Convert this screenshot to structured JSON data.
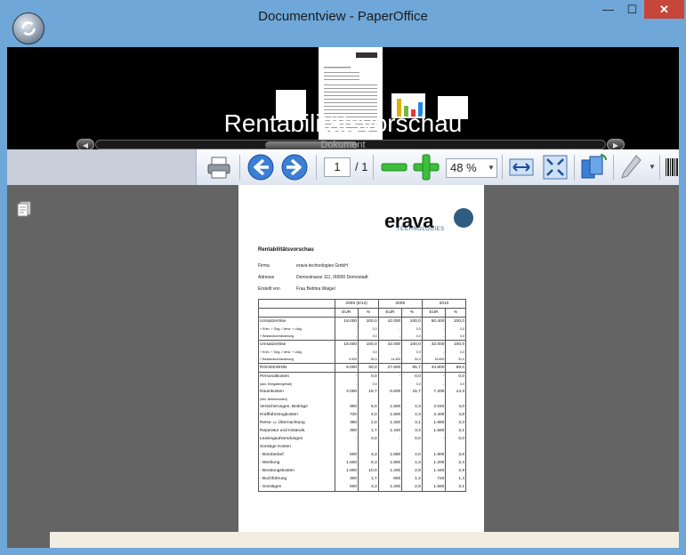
{
  "window": {
    "title": "Documentview - PaperOffice"
  },
  "titlebar": {
    "minimize": "—",
    "maximize": "☐",
    "close": "✕"
  },
  "filmstrip": {
    "title": "Rentabilitätsvorschau",
    "subtitle": "Dokument"
  },
  "toolbar": {
    "page_current": "1",
    "page_total": "/ 1",
    "zoom": "48 %"
  },
  "document": {
    "logo": "erava",
    "logo_sub": "TECHNOLOGIES",
    "title": "Rentabilitätsvorschau",
    "meta": [
      {
        "label": "Firma",
        "value": "erava technologies GmbH"
      },
      {
        "label": "Adresse",
        "value": "Demostrasse 111, 00000 Demostadt"
      },
      {
        "label": "Erstellt von",
        "value": "Frau Bettina Waigel"
      }
    ],
    "years": [
      "2009 (6/12)",
      "2009",
      "2010"
    ],
    "units": [
      "EUR",
      "%",
      "EUR",
      "%",
      "EUR",
      "%"
    ],
    "rows": [
      {
        "label": "Umsatzerlöse",
        "v": [
          "18.000",
          "100,0",
          "42.000",
          "100,0",
          "50.400",
          "100,0"
        ],
        "style": ""
      },
      {
        "label": "+ Erlm. + Geg. / Verw. + Ustg.",
        "v": [
          "-",
          "0,0",
          "-",
          "0,0",
          "-",
          "0,0"
        ],
        "style": "small"
      },
      {
        "label": "+ Bestandsveränderung",
        "v": [
          "-",
          "0,0",
          "-",
          "0,0",
          "-",
          "0,0"
        ],
        "style": "small"
      },
      {
        "label": "Umsatzerlöse",
        "v": [
          "18.000",
          "100,0",
          "42.000",
          "100,0",
          "42.000",
          "100,0"
        ],
        "style": "line"
      },
      {
        "label": "+ Erlm. + Geg. / Verw. + Ustg.",
        "v": [
          "-",
          "0,0",
          "-",
          "0,0",
          "-",
          "0,0"
        ],
        "style": "small"
      },
      {
        "label": "+ Bestandsveränderung",
        "v": [
          "9.000",
          "50,0",
          "14.400",
          "34,3",
          "15.600",
          "31,0"
        ],
        "style": "small"
      },
      {
        "label": "ROHGEWINN",
        "v": [
          "9.000",
          "50,0",
          "27.600",
          "65,7",
          "34.800",
          "69,0"
        ],
        "style": "line"
      },
      {
        "label": "Personalkosten",
        "v": [
          "-",
          "0,0",
          "-",
          "0,0",
          "-",
          "0,0"
        ],
        "style": "line"
      },
      {
        "label": "(dav. Ehegattengehalt)",
        "v": [
          "-",
          "0,0",
          "-",
          "0,0",
          "-",
          "0,0"
        ],
        "style": "small"
      },
      {
        "label": "Raumkosten",
        "v": [
          "3.000",
          "16,7",
          "6.600",
          "15,7",
          "7.200",
          "14,3"
        ],
        "style": ""
      },
      {
        "label": "(inkl. Nebenkosten)",
        "v": [
          "",
          "",
          "",
          "",
          "",
          ""
        ],
        "style": "small"
      },
      {
        "label": "Versicherungen, Beiträge",
        "v": [
          "900",
          "5,0",
          "1.800",
          "4,3",
          "2.040",
          "4,0"
        ],
        "style": ""
      },
      {
        "label": "Kraftfahrzeugkosten",
        "v": [
          "720",
          "4,0",
          "1.800",
          "4,3",
          "2.400",
          "4,8"
        ],
        "style": ""
      },
      {
        "label": "Reise- u. Übernachtung",
        "v": [
          "360",
          "2,0",
          "1.320",
          "3,1",
          "1.680",
          "3,3"
        ],
        "style": ""
      },
      {
        "label": "Reparatur und Instands.",
        "v": [
          "300",
          "1,7",
          "1.440",
          "3,4",
          "1.560",
          "3,1"
        ],
        "style": ""
      },
      {
        "label": "Leasingaufwendungen",
        "v": [
          "-",
          "0,0",
          "-",
          "0,0",
          "-",
          "0,0"
        ],
        "style": ""
      },
      {
        "label": "Sonstige Kosten",
        "v": [
          "",
          "",
          "",
          "",
          "",
          ""
        ],
        "style": ""
      },
      {
        "label": "- Bürobedarf",
        "v": [
          "600",
          "3,3",
          "1.680",
          "4,0",
          "1.800",
          "3,6"
        ],
        "style": ""
      },
      {
        "label": "- Werbung",
        "v": [
          "1.500",
          "8,3",
          "1.800",
          "4,3",
          "1.200",
          "2,4"
        ],
        "style": ""
      },
      {
        "label": "- Beratungskosten",
        "v": [
          "1.800",
          "10,0",
          "1.200",
          "2,9",
          "1.440",
          "2,9"
        ],
        "style": ""
      },
      {
        "label": "- Buchführung",
        "v": [
          "300",
          "1,7",
          "600",
          "1,4",
          "720",
          "1,4"
        ],
        "style": ""
      },
      {
        "label": "- Sonstiges",
        "v": [
          "600",
          "3,3",
          "1.200",
          "2,9",
          "1.560",
          "3,1"
        ],
        "style": ""
      }
    ]
  },
  "colors": {
    "titlebar": "#6ea7d8",
    "close": "#c7463b",
    "viewer_bg": "#646464",
    "accent_blue": "#2f5d82"
  }
}
